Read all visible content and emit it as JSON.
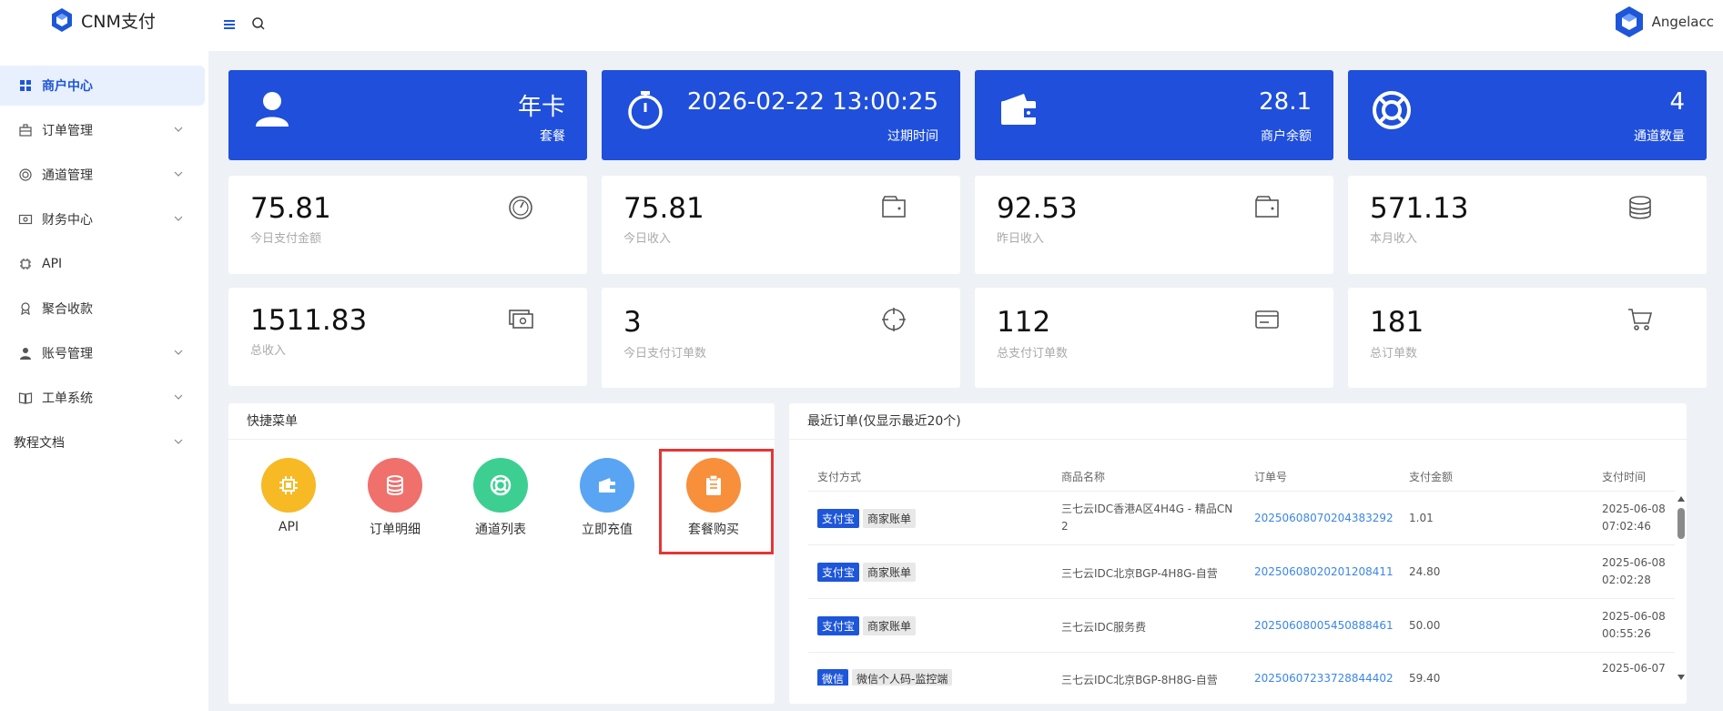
{
  "header": {
    "brand": "CNM支付",
    "user": "Angelacc"
  },
  "sidebar": {
    "items": [
      {
        "label": "商户中心",
        "icon": "grid-icon",
        "active": true
      },
      {
        "label": "订单管理",
        "icon": "briefcase-icon"
      },
      {
        "label": "通道管理",
        "icon": "lifebuoy-icon"
      },
      {
        "label": "财务中心",
        "icon": "money-icon"
      },
      {
        "label": "API",
        "icon": "chip-icon"
      },
      {
        "label": "聚合收款",
        "icon": "badge-icon"
      },
      {
        "label": "账号管理",
        "icon": "user-icon"
      },
      {
        "label": "工单系统",
        "icon": "book-icon"
      },
      {
        "label": "教程文档",
        "icon": ""
      }
    ]
  },
  "top_cards": [
    {
      "value": "年卡",
      "caption": "套餐",
      "icon": "user-icon"
    },
    {
      "value": "2026-02-22 13:00:25",
      "caption": "过期时间",
      "icon": "stopwatch-icon"
    },
    {
      "value": "28.1",
      "caption": "商户余额",
      "icon": "wallet-icon"
    },
    {
      "value": "4",
      "caption": "通道数量",
      "icon": "lifebuoy-icon"
    }
  ],
  "stats": [
    {
      "value": "75.81",
      "caption": "今日支付金额",
      "icon": "gauge-icon"
    },
    {
      "value": "75.81",
      "caption": "今日收入",
      "icon": "wallet-icon"
    },
    {
      "value": "92.53",
      "caption": "昨日收入",
      "icon": "wallet-icon"
    },
    {
      "value": "571.13",
      "caption": "本月收入",
      "icon": "database-icon"
    },
    {
      "value": "1511.83",
      "caption": "总收入",
      "icon": "cash-icon"
    },
    {
      "value": "3",
      "caption": "今日支付订单数",
      "icon": "crosshair-icon"
    },
    {
      "value": "112",
      "caption": "总支付订单数",
      "icon": "credit-card-icon"
    },
    {
      "value": "181",
      "caption": "总订单数",
      "icon": "cart-icon"
    }
  ],
  "quick_menu": {
    "title": "快捷菜单",
    "items": [
      {
        "label": "API",
        "color": "#f7b924",
        "icon": "chip-icon"
      },
      {
        "label": "订单明细",
        "color": "#f0706c",
        "icon": "database-icon"
      },
      {
        "label": "通道列表",
        "color": "#3ccf91",
        "icon": "lifebuoy-icon"
      },
      {
        "label": "立即充值",
        "color": "#59a5f4",
        "icon": "wallet-icon"
      },
      {
        "label": "套餐购买",
        "color": "#f78f3b",
        "icon": "clipboard-icon"
      }
    ]
  },
  "recent_orders": {
    "title": "最近订单(仅显示最近20个)",
    "columns": [
      "支付方式",
      "商品名称",
      "订单号",
      "支付金额",
      "支付时间"
    ],
    "rows": [
      {
        "method": "支付宝",
        "tag": "商家账单",
        "product_line1": "三七云IDC香港A区4H4G - 精品CN",
        "product_line2": "2",
        "order_no": "20250608070204383292",
        "amount": "1.01",
        "date": "2025-06-08",
        "time": "07:02:46"
      },
      {
        "method": "支付宝",
        "tag": "商家账单",
        "product_line1": "三七云IDC北京BGP-4H8G-自营",
        "product_line2": "",
        "order_no": "20250608020201208411",
        "amount": "24.80",
        "date": "2025-06-08",
        "time": "02:02:28"
      },
      {
        "method": "支付宝",
        "tag": "商家账单",
        "product_line1": "三七云IDC服务费",
        "product_line2": "",
        "order_no": "20250608005450888461",
        "amount": "50.00",
        "date": "2025-06-08",
        "time": "00:55:26"
      },
      {
        "method": "微信",
        "tag": "微信个人码-监控端",
        "product_line1": "三七云IDC北京BGP-8H8G-自营",
        "product_line2": "",
        "order_no": "20250607233728844402",
        "amount": "59.40",
        "date": "2025-06-07",
        "time": ""
      }
    ]
  },
  "colors": {
    "primary": "#1f4fdb",
    "link": "#3b86e8",
    "highlight": "#e53535"
  }
}
